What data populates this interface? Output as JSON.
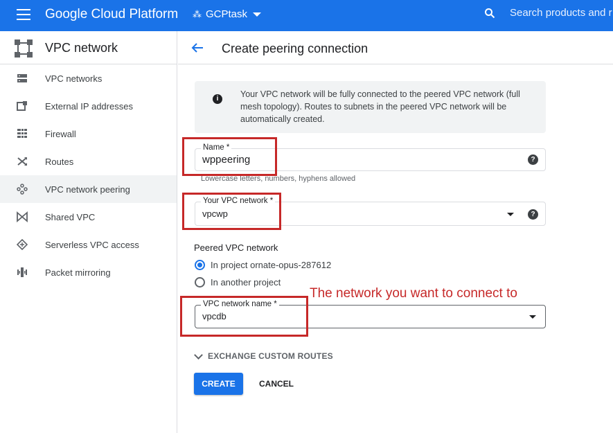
{
  "topbar": {
    "menu_icon": "hamburger-icon",
    "brand": "Google Cloud Platform",
    "project": "GCPtask",
    "search_placeholder": "Search products and r",
    "color": "#1a73e8"
  },
  "sidebar": {
    "title": "VPC network",
    "items": [
      {
        "label": "VPC networks",
        "icon": "vpc-networks-icon"
      },
      {
        "label": "External IP addresses",
        "icon": "external-ip-icon"
      },
      {
        "label": "Firewall",
        "icon": "firewall-icon"
      },
      {
        "label": "Routes",
        "icon": "routes-icon"
      },
      {
        "label": "VPC network peering",
        "icon": "peering-icon",
        "active": true
      },
      {
        "label": "Shared VPC",
        "icon": "shared-vpc-icon"
      },
      {
        "label": "Serverless VPC access",
        "icon": "serverless-icon"
      },
      {
        "label": "Packet mirroring",
        "icon": "packet-mirroring-icon"
      }
    ]
  },
  "page": {
    "title": "Create peering connection",
    "info": "Your VPC network will be fully connected to the peered VPC network (full mesh topology). Routes to subnets in the peered VPC network will be automatically created."
  },
  "form": {
    "name_label": "Name *",
    "name_value": "wppeering",
    "name_hint": "Lowercase letters, numbers, hyphens allowed",
    "vpc_label": "Your VPC network *",
    "vpc_value": "vpcwp",
    "peered_title": "Peered VPC network",
    "radio_project": "In project ornate-opus-287612",
    "radio_another": "In another project",
    "vpc_name_label": "VPC network name *",
    "vpc_name_value": "vpcdb",
    "exchange": "EXCHANGE CUSTOM ROUTES",
    "create": "CREATE",
    "cancel": "CANCEL"
  },
  "annotation": {
    "text": "The network you want to connect to",
    "color": "#c62828"
  }
}
